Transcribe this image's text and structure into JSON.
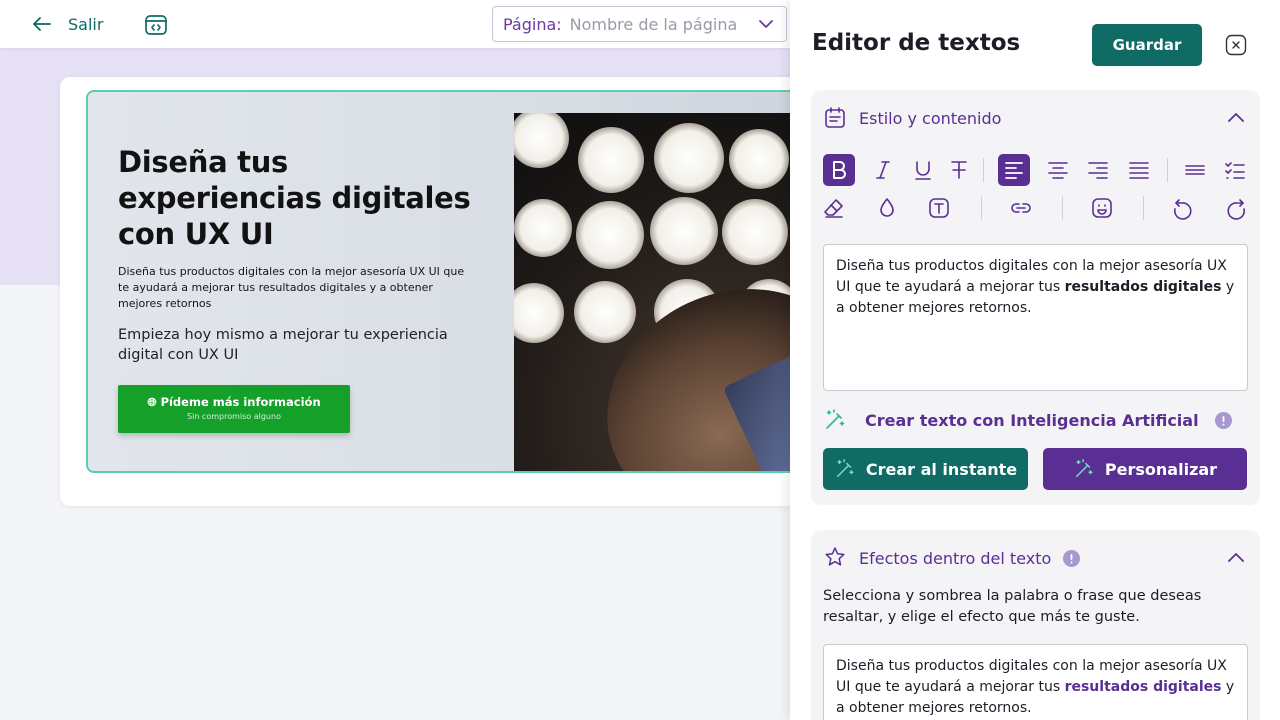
{
  "topbar": {
    "back_label": "Salir",
    "page_selector": {
      "label": "Página:",
      "placeholder": "Nombre de la página"
    }
  },
  "hero": {
    "title": "Diseña tus experiencias digitales con UX UI",
    "paragraph": "Diseña tus productos digitales con la mejor asesoría UX UI que te ayudará a mejorar tus resultados digitales y a obtener mejores retornos",
    "subheading": "Empieza hoy mismo a mejorar tu experiencia digital con UX UI",
    "cta": {
      "label": "Pídeme más información",
      "sublabel": "Sin compromiso alguno"
    }
  },
  "panel": {
    "title": "Editor de textos",
    "save_label": "Guardar",
    "style_section": {
      "title": "Estilo y contenido",
      "text_before": "Diseña tus productos digitales con la mejor asesoría UX UI que te ayudará a mejorar tus ",
      "text_bold": "resultados digitales",
      "text_after": " y a obtener mejores retornos.",
      "ai_label": "Crear texto con Inteligencia Artificial",
      "create_now_label": "Crear al instante",
      "customize_label": "Personalizar"
    },
    "effects_section": {
      "title": "Efectos dentro del texto",
      "description": "Selecciona y sombrea la palabra o frase que deseas resaltar, y elige el efecto que más te guste.",
      "text_before": "Diseña tus productos digitales con la mejor asesoría UX UI que te ayudará a mejorar tus ",
      "text_highlight": "resultados digitales",
      "text_after": " y a obtener mejores retornos."
    }
  },
  "colors": {
    "teal": "#0f6b63",
    "purple": "#5a2f94",
    "cta_green": "#15a02a",
    "band_lavender": "#e7e1f6"
  },
  "icons": [
    "arrow-left-icon",
    "layout-icon",
    "chevron-down-icon",
    "close-icon",
    "notes-icon",
    "bold-icon",
    "italic-icon",
    "underline-icon",
    "strikethrough-icon",
    "align-left-icon",
    "align-center-icon",
    "align-right-icon",
    "align-justify-icon",
    "line-spacing-icon",
    "checklist-icon",
    "eraser-icon",
    "color-drop-icon",
    "text-box-icon",
    "link-icon",
    "emoji-icon",
    "undo-icon",
    "redo-icon",
    "magic-wand-icon",
    "info-icon",
    "sparkle-icon",
    "chevron-up-icon"
  ]
}
